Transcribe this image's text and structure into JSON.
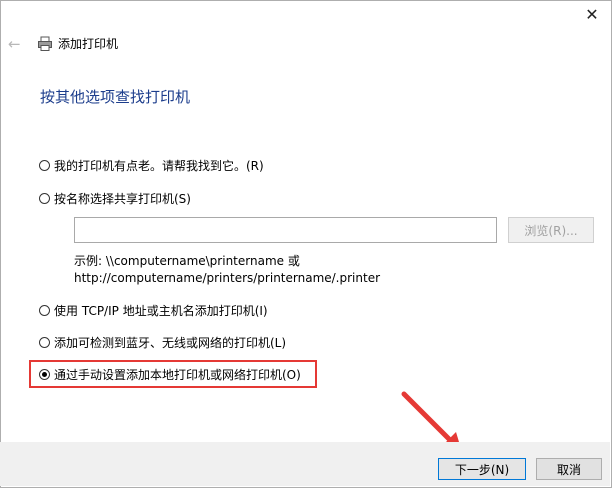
{
  "window": {
    "title": "添加打印机",
    "close_symbol": "✕",
    "back_symbol": "←",
    "icons": {
      "back": "back-arrow-icon",
      "printer": "printer-icon",
      "close": "close-icon"
    }
  },
  "heading": "按其他选项查找打印机",
  "options": [
    {
      "label": "我的打印机有点老。请帮我找到它。(R)",
      "checked": false
    },
    {
      "label": "按名称选择共享打印机(S)",
      "checked": false
    },
    {
      "label": "使用 TCP/IP 地址或主机名添加打印机(I)",
      "checked": false
    },
    {
      "label": "添加可检测到蓝牙、无线或网络的打印机(L)",
      "checked": false
    },
    {
      "label": "通过手动设置添加本地打印机或网络打印机(O)",
      "checked": true
    }
  ],
  "share_input": {
    "value": "",
    "placeholder": ""
  },
  "browse_button": "浏览(R)...",
  "example_line1": "示例: \\\\computername\\printername 或",
  "example_line2": "http://computername/printers/printername/.printer",
  "buttons": {
    "next": "下一步(N)",
    "cancel": "取消"
  },
  "colors": {
    "heading": "#1c3d8c",
    "highlight": "#e53935",
    "accent": "#0078d7"
  }
}
